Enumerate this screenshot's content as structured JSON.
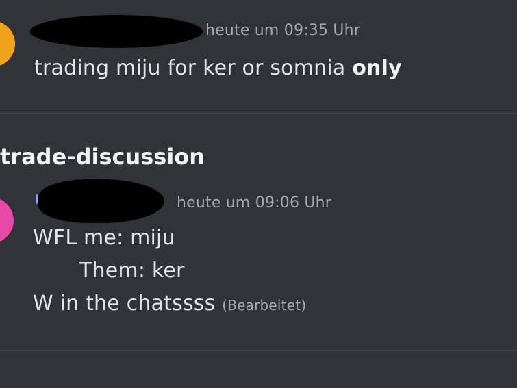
{
  "messages": [
    {
      "timestamp": "heute um 09:35 Uhr",
      "text_main": "trading miju for ker or somnia ",
      "text_bold": "only"
    },
    {
      "timestamp": "heute um 09:06 Uhr",
      "line1": "WFL me: miju",
      "line2": "Them: ker",
      "line3": "W in the chatssss",
      "edited": "(Bearbeitet)"
    }
  ],
  "channel": {
    "label": "trade-discussion"
  },
  "colors": {
    "background": "#313338",
    "timestamp": "#a6a9ae",
    "avatar_1": "#f0a21c",
    "avatar_2": "#e64aa6"
  }
}
